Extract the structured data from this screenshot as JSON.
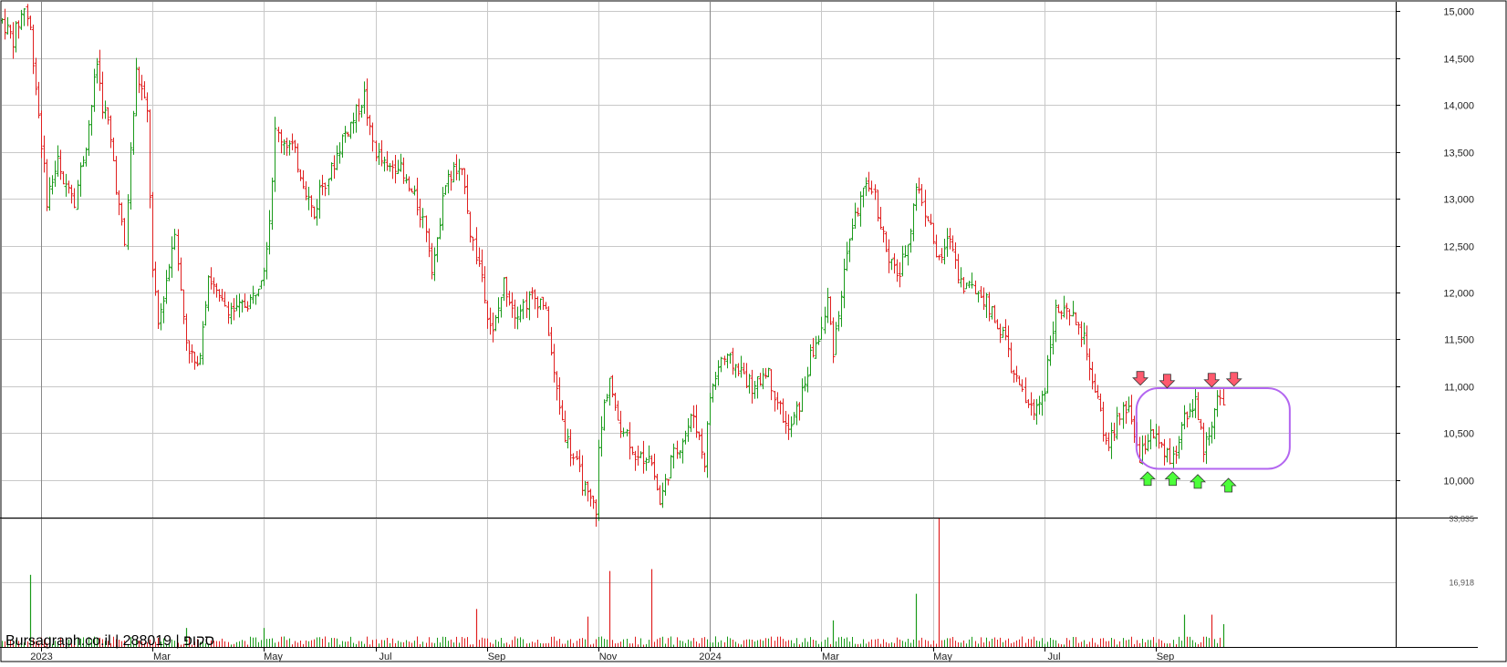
{
  "chart_data": {
    "type": "candlestick",
    "watermark": "Bursagraph.co.il | 288019 | סקופ",
    "price_axis": {
      "range": [
        9600,
        15100
      ],
      "ticks": [
        10000,
        10500,
        11000,
        11500,
        12000,
        12500,
        13000,
        13500,
        14000,
        14500,
        15000
      ],
      "tick_labels": [
        "10,000",
        "10,500",
        "11,000",
        "11,500",
        "12,000",
        "12,500",
        "13,000",
        "13,500",
        "14,000",
        "14,500",
        "15,000"
      ]
    },
    "volume_axis": {
      "range": [
        0,
        33835
      ],
      "ticks": [
        16918,
        33835
      ],
      "tick_labels": [
        "16,918",
        "33,835"
      ]
    },
    "x_ticks": [
      {
        "label": "2023",
        "month_index": 0,
        "major": true
      },
      {
        "label": "Mar",
        "month_index": 2,
        "major": false
      },
      {
        "label": "May",
        "month_index": 4,
        "major": false
      },
      {
        "label": "Jul",
        "month_index": 6,
        "major": false
      },
      {
        "label": "Sep",
        "month_index": 8,
        "major": false
      },
      {
        "label": "Nov",
        "month_index": 10,
        "major": false
      },
      {
        "label": "2024",
        "month_index": 12,
        "major": true
      },
      {
        "label": "Mar",
        "month_index": 14,
        "major": false
      },
      {
        "label": "May",
        "month_index": 16,
        "major": false
      },
      {
        "label": "Jul",
        "month_index": 18,
        "major": false
      },
      {
        "label": "Sep",
        "month_index": 20,
        "major": false
      }
    ],
    "x_range_months": [
      -0.7,
      24.3
    ],
    "price_path": [
      [
        -0.7,
        14900
      ],
      [
        -0.5,
        14700
      ],
      [
        -0.3,
        15050
      ],
      [
        -0.2,
        14800
      ],
      [
        -0.1,
        14200
      ],
      [
        0.0,
        13600
      ],
      [
        0.1,
        13000
      ],
      [
        0.2,
        13200
      ],
      [
        0.3,
        13400
      ],
      [
        0.4,
        13100
      ],
      [
        0.5,
        13200
      ],
      [
        0.6,
        13000
      ],
      [
        0.7,
        13300
      ],
      [
        0.8,
        13600
      ],
      [
        0.9,
        14000
      ],
      [
        1.0,
        14450
      ],
      [
        1.1,
        14000
      ],
      [
        1.2,
        13800
      ],
      [
        1.3,
        13400
      ],
      [
        1.4,
        12900
      ],
      [
        1.5,
        12500
      ],
      [
        1.6,
        13500
      ],
      [
        1.7,
        14350
      ],
      [
        1.8,
        14150
      ],
      [
        1.9,
        13900
      ],
      [
        2.0,
        12200
      ],
      [
        2.1,
        11650
      ],
      [
        2.3,
        12300
      ],
      [
        2.4,
        12700
      ],
      [
        2.5,
        12000
      ],
      [
        2.6,
        11500
      ],
      [
        2.8,
        11150
      ],
      [
        3.0,
        12200
      ],
      [
        3.2,
        11900
      ],
      [
        3.5,
        11800
      ],
      [
        3.8,
        11950
      ],
      [
        4.0,
        12300
      ],
      [
        4.1,
        12800
      ],
      [
        4.2,
        13700
      ],
      [
        4.5,
        13550
      ],
      [
        4.7,
        13200
      ],
      [
        4.9,
        12800
      ],
      [
        5.0,
        13100
      ],
      [
        5.2,
        13300
      ],
      [
        5.4,
        13650
      ],
      [
        5.6,
        13850
      ],
      [
        5.8,
        14100
      ],
      [
        5.9,
        13700
      ],
      [
        6.0,
        13500
      ],
      [
        6.2,
        13300
      ],
      [
        6.4,
        13400
      ],
      [
        6.5,
        13200
      ],
      [
        6.7,
        13000
      ],
      [
        6.9,
        12700
      ],
      [
        7.0,
        12300
      ],
      [
        7.1,
        12500
      ],
      [
        7.2,
        13100
      ],
      [
        7.4,
        13300
      ],
      [
        7.6,
        13200
      ],
      [
        7.7,
        12650
      ],
      [
        7.8,
        12400
      ],
      [
        7.9,
        12200
      ],
      [
        8.0,
        11800
      ],
      [
        8.1,
        11550
      ],
      [
        8.3,
        12100
      ],
      [
        8.5,
        11800
      ],
      [
        8.8,
        11950
      ],
      [
        9.0,
        11900
      ],
      [
        9.1,
        11600
      ],
      [
        9.2,
        11100
      ],
      [
        9.4,
        10500
      ],
      [
        9.6,
        10150
      ],
      [
        9.8,
        9800
      ],
      [
        9.95,
        9700
      ],
      [
        10.0,
        10300
      ],
      [
        10.1,
        10800
      ],
      [
        10.2,
        11100
      ],
      [
        10.3,
        10700
      ],
      [
        10.5,
        10500
      ],
      [
        10.7,
        10200
      ],
      [
        10.9,
        10300
      ],
      [
        11.0,
        10050
      ],
      [
        11.1,
        9750
      ],
      [
        11.3,
        10200
      ],
      [
        11.5,
        10450
      ],
      [
        11.7,
        10700
      ],
      [
        11.9,
        10200
      ],
      [
        12.0,
        10900
      ],
      [
        12.2,
        11300
      ],
      [
        12.5,
        11200
      ],
      [
        12.8,
        10950
      ],
      [
        13.0,
        11200
      ],
      [
        13.2,
        10850
      ],
      [
        13.4,
        10500
      ],
      [
        13.6,
        10800
      ],
      [
        13.8,
        11300
      ],
      [
        14.0,
        11600
      ],
      [
        14.1,
        11900
      ],
      [
        14.2,
        11400
      ],
      [
        14.3,
        11800
      ],
      [
        14.4,
        12200
      ],
      [
        14.5,
        12600
      ],
      [
        14.7,
        13000
      ],
      [
        14.9,
        13150
      ],
      [
        15.1,
        12600
      ],
      [
        15.2,
        12300
      ],
      [
        15.4,
        12200
      ],
      [
        15.6,
        12700
      ],
      [
        15.7,
        13150
      ],
      [
        15.9,
        12800
      ],
      [
        16.1,
        12300
      ],
      [
        16.3,
        12600
      ],
      [
        16.5,
        12100
      ],
      [
        16.7,
        12050
      ],
      [
        16.9,
        11950
      ],
      [
        17.1,
        11700
      ],
      [
        17.3,
        11500
      ],
      [
        17.4,
        11200
      ],
      [
        17.6,
        10900
      ],
      [
        17.8,
        10700
      ],
      [
        18.0,
        11000
      ],
      [
        18.1,
        11500
      ],
      [
        18.2,
        11800
      ],
      [
        18.4,
        11750
      ],
      [
        18.6,
        11650
      ],
      [
        18.75,
        11400
      ],
      [
        18.85,
        11000
      ],
      [
        19.0,
        10700
      ],
      [
        19.1,
        10350
      ],
      [
        19.3,
        10600
      ],
      [
        19.5,
        10800
      ],
      [
        19.7,
        10200
      ],
      [
        19.9,
        10550
      ],
      [
        20.1,
        10300
      ],
      [
        20.3,
        10200
      ],
      [
        20.5,
        10700
      ],
      [
        20.7,
        10850
      ],
      [
        20.85,
        10300
      ],
      [
        21.0,
        10650
      ],
      [
        21.1,
        10850
      ],
      [
        21.2,
        10750
      ]
    ],
    "volume_spikes": [
      {
        "month": -0.2,
        "value": 19000,
        "color": "green"
      },
      {
        "month": 0.5,
        "value": 2000,
        "color": "green"
      },
      {
        "month": 2.6,
        "value": 5000,
        "color": "green"
      },
      {
        "month": 4.0,
        "value": 5000,
        "color": "green"
      },
      {
        "month": 7.8,
        "value": 10000,
        "color": "red"
      },
      {
        "month": 9.8,
        "value": 8000,
        "color": "red"
      },
      {
        "month": 10.2,
        "value": 20000,
        "color": "red"
      },
      {
        "month": 10.95,
        "value": 20500,
        "color": "red"
      },
      {
        "month": 14.2,
        "value": 7000,
        "color": "green"
      },
      {
        "month": 15.7,
        "value": 14000,
        "color": "green"
      },
      {
        "month": 16.1,
        "value": 33835,
        "color": "red"
      },
      {
        "month": 20.5,
        "value": 8500,
        "color": "green"
      },
      {
        "month": 21.0,
        "value": 8500,
        "color": "red"
      },
      {
        "month": 21.2,
        "value": 6000,
        "color": "green"
      }
    ],
    "annotation_box": {
      "x_months": [
        19.65,
        22.4
      ],
      "y_price": [
        10120,
        10980
      ],
      "color": "#b366f0"
    },
    "arrows_down": [
      {
        "month": 19.72,
        "price": 11080
      },
      {
        "month": 20.2,
        "price": 11050
      },
      {
        "month": 21.0,
        "price": 11060
      },
      {
        "month": 21.4,
        "price": 11070
      }
    ],
    "arrows_up": [
      {
        "month": 19.85,
        "price": 10020
      },
      {
        "month": 20.3,
        "price": 10020
      },
      {
        "month": 20.75,
        "price": 9990
      },
      {
        "month": 21.3,
        "price": 9950
      }
    ],
    "colors": {
      "up": "#1a9a1a",
      "down": "#e02020",
      "grid": "#c8c8c8",
      "axis": "#000000"
    }
  }
}
